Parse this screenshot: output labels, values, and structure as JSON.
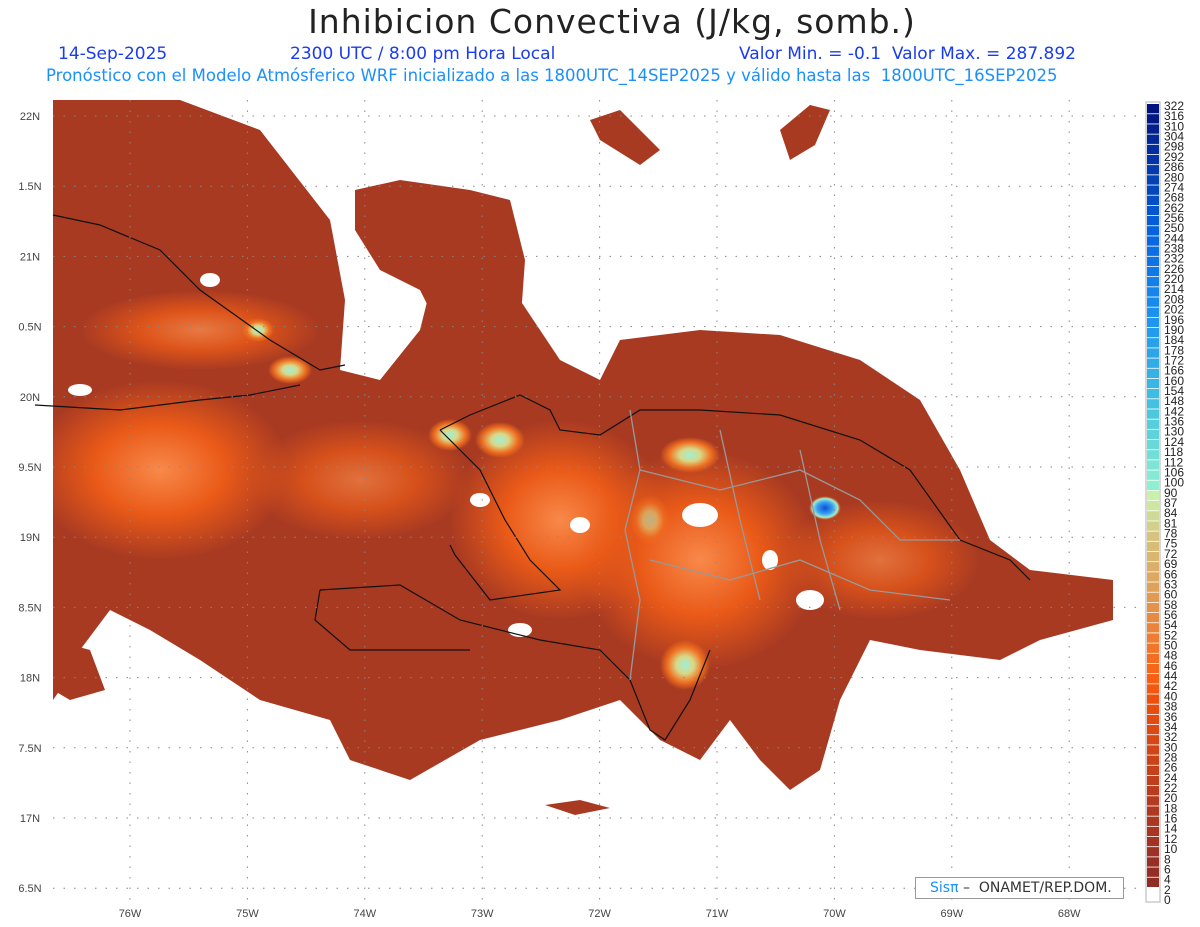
{
  "header": {
    "title": "Inhibicion Convectiva (J/kg, somb.)",
    "date": "14-Sep-2025",
    "time": "2300 UTC / 8:00 pm Hora Local",
    "minmax": "Valor Min. = -0.1  Valor Max. = 287.892",
    "subtitle": "Pronóstico con el Modelo Atmósferico WRF inicializado a las 1800UTC_14SEP2025 y válido hasta las  1800UTC_16SEP2025"
  },
  "axes": {
    "lat_labels": [
      "22N",
      "1.5N",
      "21N",
      "0.5N",
      "20N",
      "9.5N",
      "19N",
      "8.5N",
      "18N",
      "7.5N",
      "17N",
      "6.5N"
    ],
    "lon_labels": [
      "76W",
      "75W",
      "74W",
      "73W",
      "72W",
      "71W",
      "70W",
      "69W",
      "68W"
    ]
  },
  "colorbar": {
    "levels": [
      0,
      2,
      4,
      6,
      8,
      10,
      12,
      14,
      16,
      18,
      20,
      22,
      24,
      26,
      28,
      30,
      32,
      34,
      36,
      38,
      40,
      42,
      44,
      46,
      48,
      50,
      52,
      54,
      56,
      58,
      60,
      63,
      66,
      69,
      72,
      75,
      78,
      81,
      84,
      87,
      90,
      100,
      106,
      112,
      118,
      124,
      130,
      136,
      142,
      148,
      154,
      160,
      166,
      172,
      178,
      184,
      190,
      196,
      202,
      208,
      214,
      220,
      226,
      232,
      238,
      244,
      250,
      256,
      262,
      268,
      274,
      280,
      286,
      292,
      298,
      304,
      310,
      316,
      322
    ],
    "labels": [
      "0",
      "2",
      "4",
      "6",
      "8",
      "10",
      "12",
      "14",
      "16",
      "18",
      "20",
      "22",
      "24",
      "26",
      "28",
      "30",
      "32",
      "34",
      "36",
      "38",
      "40",
      "42",
      "44",
      "46",
      "48",
      "50",
      "52",
      "54",
      "56",
      "58",
      "60",
      "63",
      "66",
      "69",
      "72",
      "75",
      "78",
      "81",
      "84",
      "87",
      "90",
      "100",
      "106",
      "112",
      "118",
      "124",
      "130",
      "136",
      "142",
      "148",
      "154",
      "160",
      "166",
      "172",
      "178",
      "184",
      "190",
      "196",
      "202",
      "208",
      "214",
      "220",
      "226",
      "232",
      "238",
      "244",
      "250",
      "256",
      "262",
      "268",
      "274",
      "280",
      "286",
      "292",
      "298",
      "304",
      "310",
      "316",
      "322"
    ],
    "color_stops": [
      [
        2,
        "#8a2a26"
      ],
      [
        20,
        "#b53a1f"
      ],
      [
        40,
        "#ee4f0c"
      ],
      [
        44,
        "#fb5e10"
      ],
      [
        60,
        "#e29a52"
      ],
      [
        78,
        "#d6c47e"
      ],
      [
        90,
        "#c8f2aa"
      ],
      [
        100,
        "#8ef0d2"
      ],
      [
        148,
        "#42c2e0"
      ],
      [
        202,
        "#1a90f2"
      ],
      [
        250,
        "#0562e0"
      ],
      [
        322,
        "#00127e"
      ]
    ]
  },
  "footer": {
    "logo_brand": "Sisπ",
    "logo_text": " –  ONAMET/REP.DOM."
  }
}
